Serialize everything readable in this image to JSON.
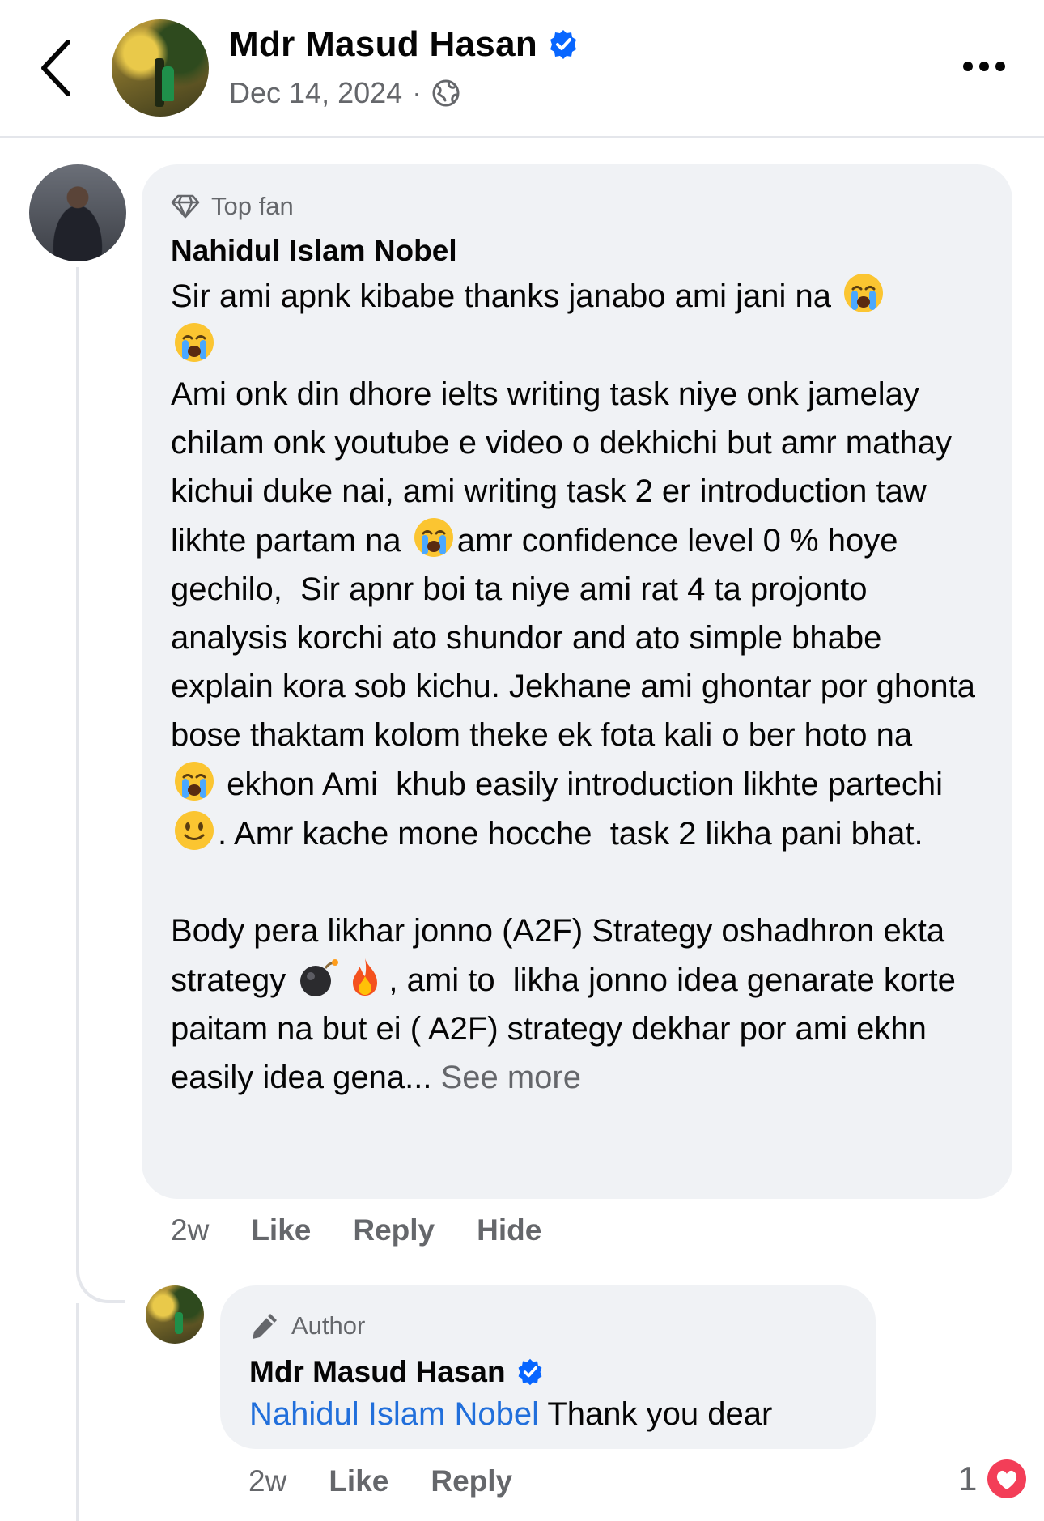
{
  "header": {
    "page_name": "Mdr Masud Hasan",
    "date": "Dec 14, 2024",
    "separator": "·"
  },
  "comment": {
    "badge": "Top fan",
    "author": "Nahidul Islam Nobel",
    "text_1": "Sir ami apnk kibabe thanks janabo ami jani na ",
    "text_2": "Ami onk din dhore ielts writing task niye onk jamelay chilam onk youtube e video o dekhichi but amr mathay kichui duke nai, ami writing task 2 er introduction taw likhte partam na ",
    "text_3": "amr confidence level 0 % hoye gechilo,  Sir apnr boi ta niye ami rat 4 ta projonto analysis korchi ato shundor and ato simple bhabe explain kora sob kichu. Jekhane ami ghontar por ghonta bose thaktam kolom theke ek fota kali o ber hoto na ",
    "text_4": " ekhon Ami  khub easily introduction likhte partechi ",
    "text_5": ". Amr kache mone hocche  task 2 likha pani bhat.",
    "text_6": "Body pera likhar jonno (A2F) Strategy oshadhron ekta strategy ",
    "text_7": ", ami to  likha jonno idea genarate korte paitam na but ei ( A2F) strategy dekhar por ami ekhn easily idea gena... ",
    "see_more": "See more",
    "time": "2w",
    "like": "Like",
    "reply": "Reply",
    "hide": "Hide"
  },
  "reply": {
    "badge": "Author",
    "author": "Mdr Masud Hasan",
    "mention": "Nahidul Islam Nobel",
    "text": " Thank you dear",
    "time": "2w",
    "like": "Like",
    "reply": "Reply",
    "reaction_count": "1"
  },
  "colors": {
    "verified": "#0866ff",
    "mention": "#216fdb",
    "bubble": "#f0f2f5",
    "secondary_text": "#65676b",
    "heart": "#f33e58"
  },
  "icons": [
    "back-chevron-icon",
    "verified-badge-icon",
    "globe-icon",
    "more-options-icon",
    "diamond-icon",
    "pencil-icon",
    "loudly-crying-face-emoji",
    "slightly-smiling-face-emoji",
    "bomb-emoji",
    "fire-emoji",
    "heart-reaction-icon"
  ]
}
